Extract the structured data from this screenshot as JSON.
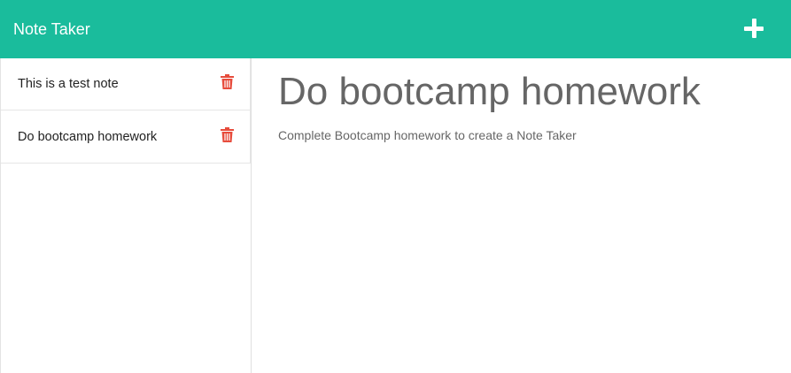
{
  "navbar": {
    "brand": "Note Taker",
    "new_note_icon": "plus-icon"
  },
  "sidebar": {
    "notes": [
      {
        "title": "This is a test note",
        "delete_icon": "trash-icon"
      },
      {
        "title": "Do bootcamp homework",
        "delete_icon": "trash-icon"
      }
    ]
  },
  "active_note": {
    "title": "Do bootcamp homework",
    "text": "Complete Bootcamp homework to create a Note Taker"
  },
  "colors": {
    "navbar_bg": "#1abc9c",
    "delete_icon": "#e74c3c",
    "main_text": "#666666"
  }
}
